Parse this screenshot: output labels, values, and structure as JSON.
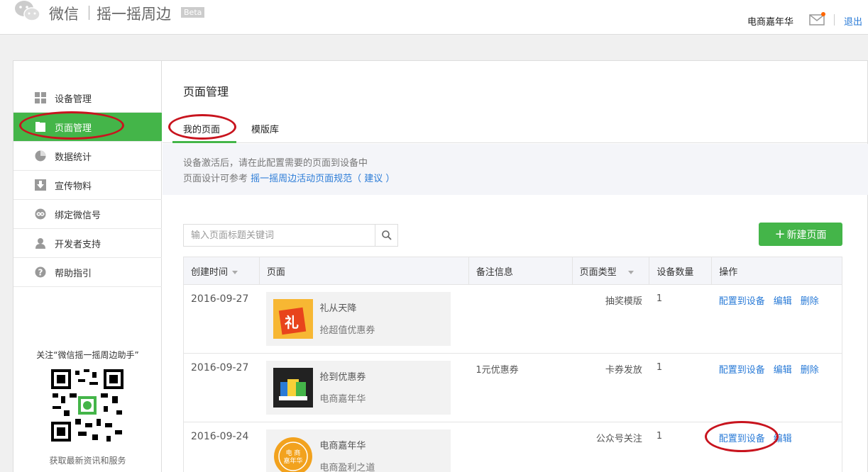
{
  "header": {
    "logo_text": "微信",
    "product_name": "摇一摇周边",
    "beta": "Beta",
    "account_name": "电商嘉年华",
    "logout": "退出"
  },
  "sidebar": {
    "items": [
      {
        "label": "设备管理",
        "icon": "grid-icon"
      },
      {
        "label": "页面管理",
        "icon": "folder-icon"
      },
      {
        "label": "数据统计",
        "icon": "pie-chart-icon"
      },
      {
        "label": "宣传物料",
        "icon": "download-icon"
      },
      {
        "label": "绑定微信号",
        "icon": "link-icon"
      },
      {
        "label": "开发者支持",
        "icon": "user-icon"
      },
      {
        "label": "帮助指引",
        "icon": "help-icon"
      }
    ],
    "active_index": 1,
    "qr_caption": "关注“微信摇一摇周边助手”",
    "qr_subcaption": "获取最新资讯和服务"
  },
  "main": {
    "title": "页面管理",
    "tabs": [
      {
        "label": "我的页面",
        "active": true
      },
      {
        "label": "模版库",
        "active": false
      }
    ],
    "notice": {
      "line1": "设备激活后，请在此配置需要的页面到设备中",
      "line2_prefix": "页面设计可参考",
      "line2_link": "摇一摇周边活动页面规范",
      "line2_suggest": "（ 建议 ）"
    },
    "search": {
      "placeholder": "输入页面标题关键词",
      "value": ""
    },
    "new_button": "新建页面",
    "table": {
      "headers": [
        "创建时间",
        "页面",
        "备注信息",
        "页面类型",
        "设备数量",
        "操作"
      ],
      "rows": [
        {
          "date": "2016-09-27",
          "title": "礼从天降",
          "subtitle": "抢超值优惠券",
          "note": "",
          "type": "抽奖模版",
          "count": "1",
          "ops": [
            "配置到设备",
            "编辑",
            "删除"
          ]
        },
        {
          "date": "2016-09-27",
          "title": "抢到优惠券",
          "subtitle": "电商嘉年华",
          "note": "1元优惠券",
          "type": "卡券发放",
          "count": "1",
          "ops": [
            "配置到设备",
            "编辑",
            "删除"
          ]
        },
        {
          "date": "2016-09-24",
          "title": "电商嘉年华",
          "subtitle": "电商盈利之道",
          "note": "",
          "type": "公众号关注",
          "count": "1",
          "ops": [
            "配置到设备",
            "编辑"
          ]
        }
      ]
    }
  },
  "colors": {
    "accent_green": "#44b549",
    "link_blue": "#2a7bd7",
    "highlight_red": "#c8141e"
  }
}
